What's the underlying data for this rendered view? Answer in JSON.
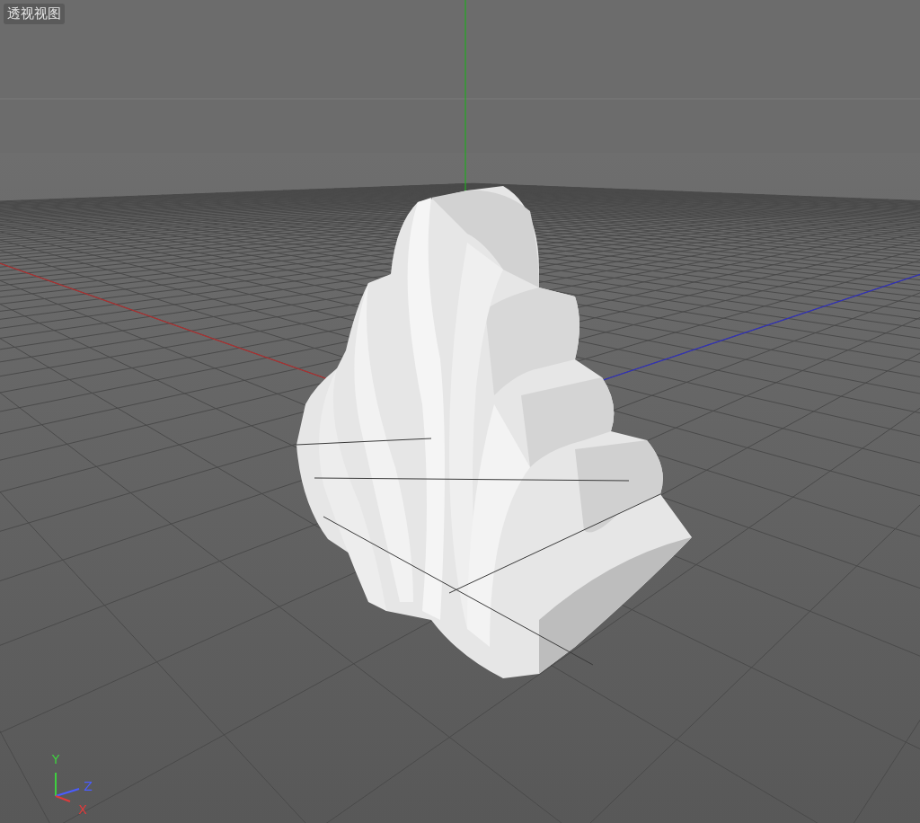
{
  "viewport": {
    "title": "透视视图"
  },
  "axis_gizmo": {
    "labels": [
      {
        "kind": "y",
        "text": "Y"
      },
      {
        "kind": "z",
        "text": "Z"
      },
      {
        "kind": "x",
        "text": "X"
      }
    ]
  }
}
